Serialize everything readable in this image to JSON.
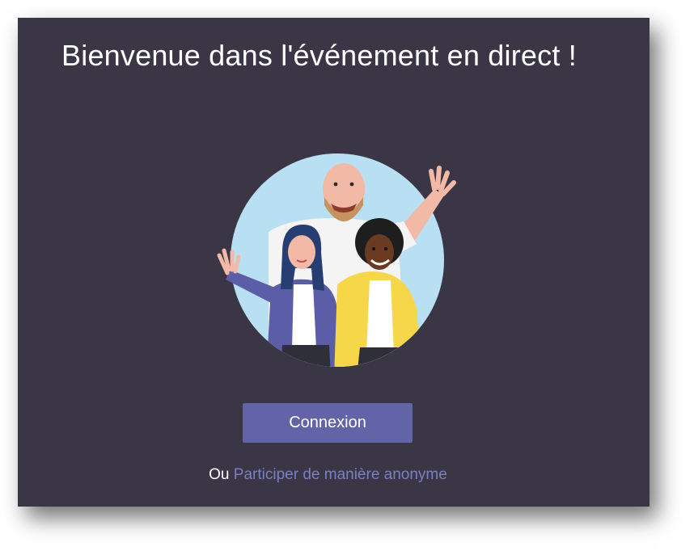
{
  "dialog": {
    "title": "Bienvenue dans l'événement en direct !",
    "illustration_icon": "welcome-people-illustration",
    "sign_in_button": "Connexion",
    "alt_prefix": "Ou",
    "anonymous_link": "Participer de manière anonyme"
  },
  "colors": {
    "background": "#3a3645",
    "accent": "#6264a7",
    "link": "#7b7fc4",
    "text": "#ffffff"
  }
}
